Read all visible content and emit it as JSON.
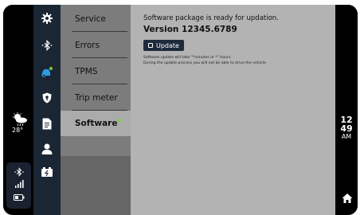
{
  "status": {
    "temperature": "28°",
    "weather_icon": "cloud-sun-rain-icon",
    "bluetooth_icon": "bluetooth-icon",
    "signal_icon": "signal-icon",
    "battery_icon": "battery-icon"
  },
  "icon_nav": [
    {
      "name": "gear-icon"
    },
    {
      "name": "bluetooth-icon"
    },
    {
      "name": "car-diagnostic-icon"
    },
    {
      "name": "shield-icon"
    },
    {
      "name": "document-icon"
    },
    {
      "name": "user-icon"
    },
    {
      "name": "battery-charging-icon"
    }
  ],
  "menu": {
    "items": [
      {
        "label": "Service"
      },
      {
        "label": "Errors"
      },
      {
        "label": "TPMS"
      },
      {
        "label": "Trip meter"
      },
      {
        "label": "Software",
        "selected": true
      }
    ]
  },
  "content": {
    "message": "Software package is ready for updation.",
    "version": "Version 12345.6789",
    "update_button": "Update",
    "note_line1": "Software update will take \"*minutes or *\" hours.",
    "note_line2": "During the update process you will not be able to drive the vehicle."
  },
  "clock": {
    "hour": "12",
    "minute": "49",
    "ampm": "AM"
  },
  "home_icon": "home-icon",
  "colors": {
    "accent_green": "#7ec843",
    "accent_blue": "#2d9cdb",
    "nav_bg": "#1b2634"
  }
}
